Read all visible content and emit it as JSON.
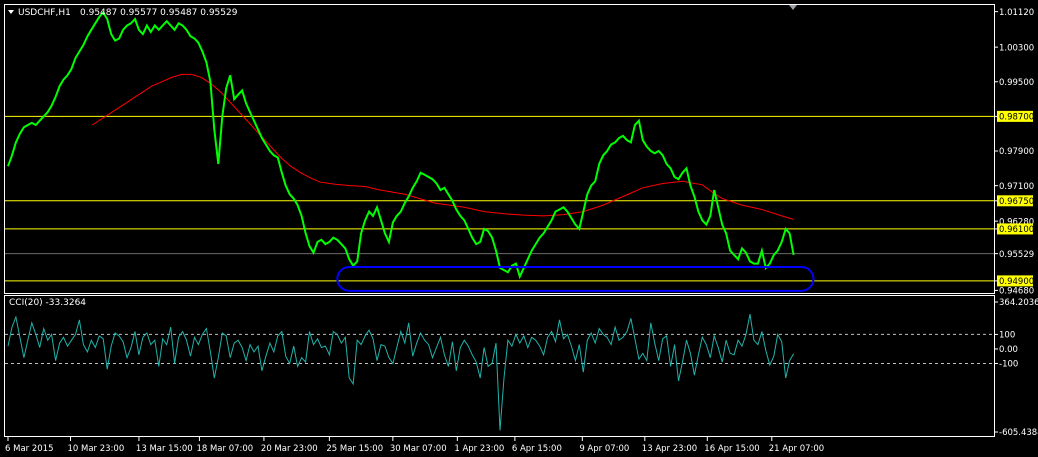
{
  "header": {
    "symbol": "USDCHF,H1",
    "ohlc": "0.95487 0.95577 0.95487 0.95529",
    "collapse_icon": "triangle-down-icon",
    "shift_marker_icon": "triangle-down-icon"
  },
  "indicator": {
    "label": "CCI(20) -33.3264"
  },
  "colors": {
    "background": "#000000",
    "price": "#00ff00",
    "moving_average": "#ff0000",
    "horizontal_lines": "#ffff00",
    "level_tag_bg": "#ffff00",
    "ellipse": "#0000ff",
    "cci": "#20b2aa",
    "frame": "#ffffff"
  },
  "chart_data": [
    {
      "type": "line",
      "name": "price-panel",
      "ylim": [
        0.9462,
        1.0125
      ],
      "y_ticks": [
        "1.01120",
        "1.00300",
        "0.99500",
        "0.98700",
        "0.97900",
        "0.97100",
        "0.96750",
        "0.96280",
        "0.96100",
        "0.95529",
        "0.94900",
        "0.94680"
      ],
      "x_tick_labels": [
        "6 Mar 2015",
        "10 Mar 23:00",
        "13 Mar 15:00",
        "18 Mar 07:00",
        "20 Mar 23:00",
        "25 Mar 15:00",
        "30 Mar 07:00",
        "1 Apr 23:00",
        "6 Apr 15:00",
        "9 Apr 07:00",
        "13 Apr 23:00",
        "16 Apr 15:00",
        "21 Apr 07:00"
      ],
      "x": [
        0,
        4,
        8,
        12,
        16,
        20,
        24,
        28,
        32,
        36,
        40,
        44,
        48,
        52,
        56,
        60,
        64,
        68,
        72,
        76,
        80,
        84,
        88,
        92,
        96,
        100,
        104,
        108,
        112,
        116,
        120,
        124,
        128,
        132,
        136,
        140,
        144,
        148,
        152,
        156,
        160,
        164,
        168,
        172,
        176,
        180,
        184,
        188,
        192,
        196,
        200,
        204,
        208,
        212,
        216,
        220,
        224,
        228,
        232,
        236,
        240,
        244,
        248,
        252,
        256,
        260,
        264,
        268,
        272,
        276,
        280,
        284,
        288,
        292,
        296,
        300,
        304,
        308,
        312,
        316,
        320,
        324,
        328,
        332,
        336,
        340,
        344,
        348,
        352,
        356,
        360,
        364,
        368,
        372,
        376,
        380,
        384,
        388,
        392,
        396,
        400,
        404,
        408,
        412,
        416,
        420,
        424,
        428,
        432,
        436,
        440,
        444,
        448,
        452,
        456,
        460,
        464,
        468,
        472,
        476,
        480,
        484,
        488,
        492,
        496,
        500,
        504,
        508,
        512,
        516,
        520,
        524,
        528,
        532,
        536,
        540,
        544,
        548,
        552,
        556,
        560,
        564,
        568,
        572,
        576,
        580,
        584,
        588,
        592,
        596,
        600,
        604,
        608,
        612,
        616,
        620,
        624,
        628,
        632,
        636,
        640,
        644,
        648,
        652,
        656,
        660,
        664,
        668,
        672,
        676,
        680,
        684,
        688,
        692,
        696,
        700,
        704,
        708,
        712,
        716,
        720,
        724,
        728,
        732,
        736,
        740,
        744,
        748,
        752,
        756,
        760,
        764,
        768,
        772,
        776,
        780,
        784,
        788,
        792
      ],
      "x_tick_positions": [
        0,
        63,
        132,
        193,
        258,
        324,
        388,
        453,
        511,
        579,
        642,
        705,
        770
      ],
      "series": [
        {
          "name": "USDCHF,H1",
          "values": [
            0.9755,
            0.978,
            0.981,
            0.983,
            0.9845,
            0.985,
            0.9855,
            0.985,
            0.986,
            0.987,
            0.988,
            0.9895,
            0.9915,
            0.994,
            0.9955,
            0.9965,
            0.998,
            1.0005,
            1.002,
            1.0035,
            1.0055,
            1.007,
            1.0085,
            1.01,
            1.011,
            1.0095,
            1.006,
            1.0045,
            1.005,
            1.007,
            1.008,
            1.0085,
            1.0095,
            1.007,
            1.006,
            1.008,
            1.0065,
            1.008,
            1.007,
            1.008,
            1.009,
            1.008,
            1.007,
            1.0085,
            1.008,
            1.007,
            1.0055,
            1.005,
            1.004,
            1.002,
            0.9995,
            0.995,
            0.984,
            0.976,
            0.987,
            0.9935,
            0.9965,
            0.991,
            0.992,
            0.993,
            0.99,
            0.988,
            0.986,
            0.984,
            0.982,
            0.9805,
            0.979,
            0.978,
            0.9775,
            0.974,
            0.971,
            0.969,
            0.968,
            0.9665,
            0.964,
            0.96,
            0.957,
            0.9555,
            0.958,
            0.9585,
            0.9575,
            0.958,
            0.959,
            0.9585,
            0.9575,
            0.9565,
            0.954,
            0.9525,
            0.9535,
            0.96,
            0.963,
            0.965,
            0.964,
            0.966,
            0.963,
            0.96,
            0.958,
            0.9625,
            0.964,
            0.965,
            0.967,
            0.9685,
            0.9705,
            0.972,
            0.974,
            0.9735,
            0.973,
            0.9725,
            0.9715,
            0.97,
            0.9705,
            0.969,
            0.9675,
            0.9655,
            0.964,
            0.963,
            0.961,
            0.959,
            0.9575,
            0.958,
            0.961,
            0.9605,
            0.959,
            0.956,
            0.952,
            0.9515,
            0.951,
            0.9525,
            0.953,
            0.95,
            0.952,
            0.954,
            0.956,
            0.9575,
            0.959,
            0.96,
            0.9615,
            0.963,
            0.965,
            0.9655,
            0.966,
            0.965,
            0.9635,
            0.962,
            0.961,
            0.965,
            0.969,
            0.971,
            0.972,
            0.976,
            0.978,
            0.979,
            0.9805,
            0.981,
            0.982,
            0.9825,
            0.9815,
            0.981,
            0.985,
            0.986,
            0.9815,
            0.98,
            0.979,
            0.9785,
            0.979,
            0.978,
            0.976,
            0.975,
            0.973,
            0.9725,
            0.974,
            0.975,
            0.971,
            0.9685,
            0.965,
            0.963,
            0.962,
            0.964,
            0.97,
            0.966,
            0.962,
            0.96,
            0.956,
            0.955,
            0.954,
            0.9565,
            0.9555,
            0.9535,
            0.953,
            0.953,
            0.956,
            0.952,
            0.953,
            0.955,
            0.956,
            0.958,
            0.961,
            0.96,
            0.955,
            0.953,
            0.9545,
            0.9553
          ]
        },
        {
          "name": "moving-average",
          "values": [
            0.985,
            0.9865,
            0.988,
            0.9895,
            0.991,
            0.9925,
            0.994,
            0.995,
            0.996,
            0.9967,
            0.9967,
            0.996,
            0.9945,
            0.9925,
            0.99,
            0.9875,
            0.985,
            0.9825,
            0.98,
            0.9775,
            0.9755,
            0.974,
            0.9728,
            0.9718,
            0.9713,
            0.971,
            0.9708,
            0.97,
            0.969,
            0.967,
            0.966,
            0.965,
            0.9645,
            0.9642,
            0.964,
            0.9643,
            0.965,
            0.9665,
            0.9685,
            0.9705,
            0.9715,
            0.972,
            0.9712,
            0.9695,
            0.968,
            0.9665,
            0.9655,
            0.964,
            0.9632
          ],
          "x": [
            85,
            95,
            105,
            115,
            125,
            135,
            145,
            155,
            165,
            175,
            185,
            195,
            205,
            215,
            225,
            235,
            245,
            255,
            265,
            275,
            285,
            295,
            305,
            315,
            330,
            345,
            360,
            375,
            400,
            430,
            460,
            480,
            500,
            520,
            540,
            560,
            580,
            600,
            620,
            640,
            660,
            680,
            700,
            710,
            720,
            740,
            760,
            780,
            792
          ]
        }
      ],
      "horizontal_lines": [
        {
          "value": 0.987,
          "label": "0.98700",
          "tagged": true
        },
        {
          "value": 0.9675,
          "label": "0.96750",
          "tagged": true
        },
        {
          "value": 0.961,
          "label": "0.96100",
          "tagged": true
        },
        {
          "value": 0.949,
          "label": "0.94900",
          "tagged": true
        }
      ],
      "current_price_line": {
        "value": 0.95529,
        "label": "0.95529"
      },
      "ellipse": {
        "x_from": 332,
        "x_to": 812,
        "y_from": 0.9467,
        "y_to": 0.9522
      }
    },
    {
      "type": "line",
      "name": "cci-panel",
      "ylim": [
        -605.4384,
        364.2036
      ],
      "y_ticks": [
        "364.2036",
        "100",
        "0.00",
        "-100",
        "-605.4384"
      ],
      "levels": [
        100,
        -100
      ],
      "series": [
        {
          "name": "CCI(20)",
          "values": [
            20,
            150,
            220,
            80,
            -60,
            60,
            180,
            100,
            10,
            140,
            60,
            100,
            -80,
            40,
            80,
            20,
            60,
            100,
            200,
            30,
            -20,
            60,
            10,
            90,
            70,
            -140,
            20,
            110,
            90,
            50,
            -60,
            10,
            120,
            -40,
            80,
            110,
            30,
            60,
            -120,
            70,
            30,
            150,
            -100,
            80,
            120,
            60,
            -50,
            80,
            30,
            100,
            140,
            -20,
            -200,
            -60,
            110,
            90,
            -60,
            40,
            60,
            10,
            -80,
            30,
            -20,
            20,
            -150,
            -50,
            40,
            -20,
            90,
            120,
            -50,
            -100,
            20,
            -120,
            -60,
            -90,
            120,
            30,
            70,
            10,
            20,
            -40,
            120,
            100,
            40,
            80,
            -200,
            -240,
            60,
            30,
            90,
            130,
            70,
            -80,
            30,
            20,
            -60,
            -100,
            10,
            120,
            40,
            180,
            -50,
            40,
            110,
            60,
            30,
            -60,
            10,
            80,
            -40,
            -120,
            50,
            -150,
            10,
            60,
            20,
            -40,
            -90,
            -200,
            10,
            -120,
            -100,
            40,
            -560,
            -200,
            60,
            20,
            100,
            40,
            90,
            10,
            80,
            60,
            20,
            -40,
            80,
            120,
            50,
            200,
            70,
            100,
            20,
            -80,
            30,
            -160,
            60,
            110,
            40,
            140,
            100,
            80,
            30,
            150,
            60,
            80,
            120,
            210,
            70,
            -70,
            -30,
            -80,
            180,
            40,
            -80,
            70,
            90,
            -120,
            30,
            -220,
            -90,
            60,
            -30,
            -180,
            -40,
            80,
            30,
            -60,
            90,
            10,
            -90,
            60,
            -30,
            -40,
            60,
            20,
            100,
            240,
            60,
            30,
            120,
            -10,
            -110,
            -50,
            100,
            50,
            -200,
            -80,
            -33
          ]
        }
      ]
    }
  ]
}
